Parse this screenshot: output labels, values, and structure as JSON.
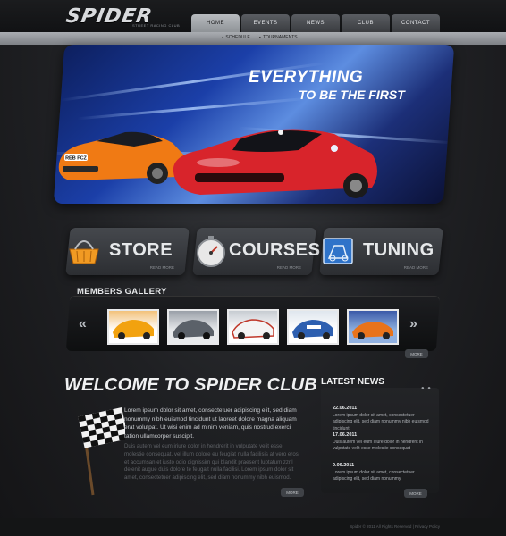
{
  "header": {
    "logo": "SPIDER",
    "logo_tagline": "STREET RACING CLUB",
    "nav": [
      "HOME",
      "EVENTS",
      "NEWS",
      "CLUB",
      "CONTACT"
    ],
    "subnav": [
      "SCHEDULE",
      "TOURNAMENTS"
    ]
  },
  "hero": {
    "line1": "EVERYTHING",
    "line2": "TO BE THE FIRST",
    "plate": "REB FCZ"
  },
  "services": [
    {
      "label": "STORE",
      "more": "READ MORE",
      "icon": "basket-icon"
    },
    {
      "label": "COURSES",
      "more": "READ MORE",
      "icon": "stopwatch-icon"
    },
    {
      "label": "TUNING",
      "more": "READ MORE",
      "icon": "blueprint-icon"
    }
  ],
  "gallery": {
    "title": "MEMBERS GALLERY",
    "more": "MORE",
    "prev": "«",
    "next": "»"
  },
  "welcome": {
    "title": "WELCOME TO SPIDER CLUB",
    "p1": "Lorem ipsum dolor sit amet, consectetuer adipiscing elit, sed diam nonummy nibh euismod tincidunt ut laoreet dolore magna aliquam erat volutpat. Ut wisi enim ad minim veniam, quis nostrud exerci tation ullamcorper suscipit.",
    "p2": "Duis autem vel eum iriure dolor in hendrerit in vulputate velit esse molestie consequat, vel illum dolore eu feugiat nulla facilisis at vero eros et accumsan et iusto odio dignissim qui blandit praesent luptatum zzril delenit augue duis dolore te feugait nulla facilisi. Lorem ipsum dolor sit amet, consectetuer adipiscing elit, sed diam nonummy nibh euismod.",
    "more": "MORE"
  },
  "news": {
    "title": "LATEST NEWS",
    "items": [
      {
        "date": "22.06.2011",
        "text": "Lorem ipsum dolor sit amet, consectetuer adipiscing elit, sed diam nonummy nibh euismod tincidunt"
      },
      {
        "date": "17.06.2011",
        "text": "Duis autem vel eum iriure dolor in hendrerit in vulputate velit esse molestie consequat"
      },
      {
        "date": "9.06.2011",
        "text": "Lorem ipsum dolor sit amet, consectetuer adipiscing elit, sed diam nonummy"
      }
    ],
    "more": "MORE"
  },
  "footer": {
    "text": "Spider © 2011 All Rights Reserved  |  Privacy Policy"
  },
  "colors": {
    "background": "#1f2023",
    "nav_active": "#b8bbbf",
    "hero_blue": "#1b3fa8",
    "car_red": "#d8242b",
    "car_orange": "#f07a14"
  }
}
